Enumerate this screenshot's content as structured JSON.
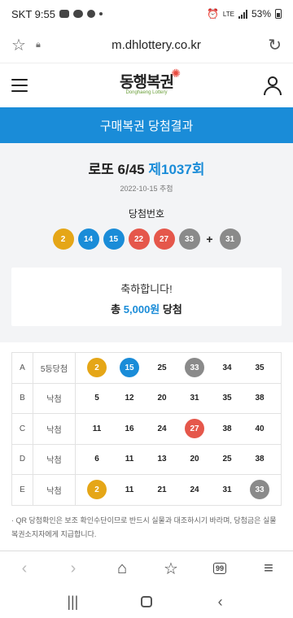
{
  "status_bar": {
    "carrier_time": "SKT 9:55",
    "network": "LTE",
    "battery": "53%"
  },
  "browser": {
    "url": "m.dhlottery.co.kr"
  },
  "site": {
    "logo_text": "동행복권",
    "logo_subtext": "Donghaeng Lottery"
  },
  "banner": {
    "title": "구매복권 당첨결과"
  },
  "draw": {
    "game": "로또 6/45",
    "round": "제1037회",
    "date": "2022-10-15 추첨",
    "winning_label": "당첨번호",
    "numbers": [
      {
        "n": "2",
        "color": "#e5a617"
      },
      {
        "n": "14",
        "color": "#1a8cd8"
      },
      {
        "n": "15",
        "color": "#1a8cd8"
      },
      {
        "n": "22",
        "color": "#e5574b"
      },
      {
        "n": "27",
        "color": "#e5574b"
      },
      {
        "n": "33",
        "color": "#8a8a8a"
      }
    ],
    "plus": "+",
    "bonus": {
      "n": "31",
      "color": "#8a8a8a"
    }
  },
  "summary": {
    "message": "축하합니다!",
    "prefix": "총",
    "amount": "5,000원",
    "suffix": "당첨"
  },
  "games": [
    {
      "id": "A",
      "result": "5등당첨",
      "numbers": [
        {
          "n": "2",
          "hit": true,
          "color": "#e5a617"
        },
        {
          "n": "15",
          "hit": true,
          "color": "#1a8cd8"
        },
        {
          "n": "25",
          "hit": false
        },
        {
          "n": "33",
          "hit": true,
          "color": "#8a8a8a"
        },
        {
          "n": "34",
          "hit": false
        },
        {
          "n": "35",
          "hit": false
        }
      ]
    },
    {
      "id": "B",
      "result": "낙첨",
      "numbers": [
        {
          "n": "5",
          "hit": false
        },
        {
          "n": "12",
          "hit": false
        },
        {
          "n": "20",
          "hit": false
        },
        {
          "n": "31",
          "hit": false
        },
        {
          "n": "35",
          "hit": false
        },
        {
          "n": "38",
          "hit": false
        }
      ]
    },
    {
      "id": "C",
      "result": "낙첨",
      "numbers": [
        {
          "n": "11",
          "hit": false
        },
        {
          "n": "16",
          "hit": false
        },
        {
          "n": "24",
          "hit": false
        },
        {
          "n": "27",
          "hit": true,
          "color": "#e5574b"
        },
        {
          "n": "38",
          "hit": false
        },
        {
          "n": "40",
          "hit": false
        }
      ]
    },
    {
      "id": "D",
      "result": "낙첨",
      "numbers": [
        {
          "n": "6",
          "hit": false
        },
        {
          "n": "11",
          "hit": false
        },
        {
          "n": "13",
          "hit": false
        },
        {
          "n": "20",
          "hit": false
        },
        {
          "n": "25",
          "hit": false
        },
        {
          "n": "38",
          "hit": false
        }
      ]
    },
    {
      "id": "E",
      "result": "낙첨",
      "numbers": [
        {
          "n": "2",
          "hit": true,
          "color": "#e5a617"
        },
        {
          "n": "11",
          "hit": false
        },
        {
          "n": "21",
          "hit": false
        },
        {
          "n": "24",
          "hit": false
        },
        {
          "n": "31",
          "hit": false
        },
        {
          "n": "33",
          "hit": true,
          "color": "#8a8a8a"
        }
      ]
    }
  ],
  "note": "· QR 당첨확인은 보조 확인수단이므로 반드시 실물과 대조하시기 바라며, 당첨금은 실물복권소지자에게 지급합니다.",
  "bottom_nav": {
    "tabs_count": "99"
  },
  "icons": [
    "star-icon",
    "lock-icon",
    "reload-icon",
    "menu-icon",
    "user-icon",
    "back-icon",
    "forward-icon",
    "home-icon",
    "bookmark-icon",
    "tabs-icon",
    "more-icon",
    "recent-apps-icon",
    "android-home-icon",
    "android-back-icon"
  ]
}
